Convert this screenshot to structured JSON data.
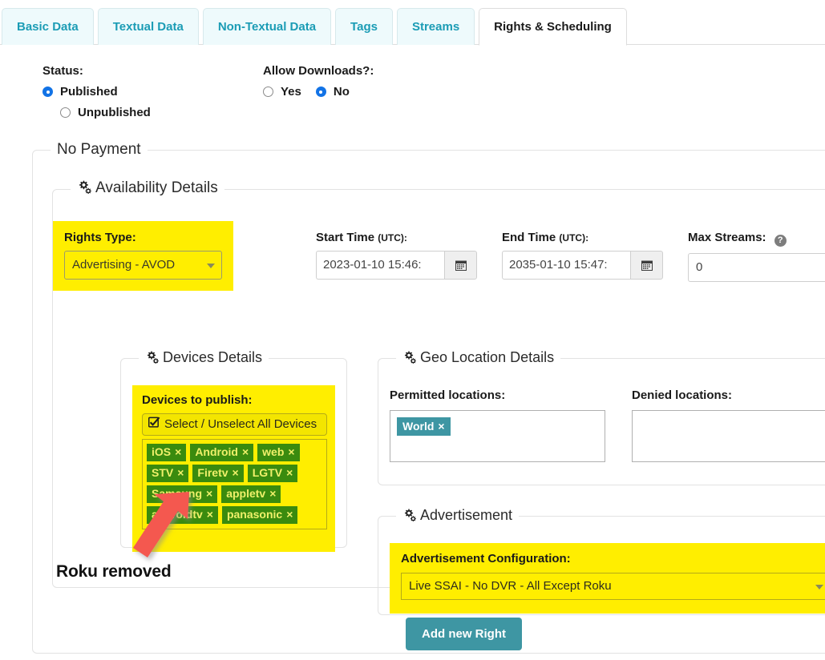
{
  "tabs": [
    {
      "label": "Basic Data",
      "active": false
    },
    {
      "label": "Textual Data",
      "active": false
    },
    {
      "label": "Non-Textual Data",
      "active": false
    },
    {
      "label": "Tags",
      "active": false
    },
    {
      "label": "Streams",
      "active": false
    },
    {
      "label": "Rights & Scheduling",
      "active": true
    }
  ],
  "status": {
    "label": "Status:",
    "options": [
      {
        "label": "Published",
        "checked": true
      },
      {
        "label": "Unpublished",
        "checked": false
      }
    ]
  },
  "downloads": {
    "label": "Allow Downloads?:",
    "options": [
      {
        "label": "Yes",
        "checked": false
      },
      {
        "label": "No",
        "checked": true
      }
    ]
  },
  "payment_fieldset": {
    "legend": "No Payment"
  },
  "availability": {
    "legend": "Availability Details",
    "rights_type": {
      "label": "Rights Type:",
      "value": "Advertising - AVOD"
    },
    "start_time": {
      "label": "Start Time",
      "unit": "(UTC):",
      "value": "2023-01-10 15:46:",
      "icon": "calendar-icon"
    },
    "end_time": {
      "label": "End Time",
      "unit": "(UTC):",
      "value": "2035-01-10 15:47:",
      "icon": "calendar-icon"
    },
    "max_streams": {
      "label": "Max Streams:",
      "value": "0",
      "help_icon": "help-circle-icon"
    }
  },
  "devices": {
    "legend": "Devices Details",
    "title": "Devices to publish:",
    "select_all_label": "Select / Unselect All Devices",
    "select_all_checked": true,
    "tags": [
      "iOS",
      "Android",
      "web",
      "STV",
      "Firetv",
      "LGTV",
      "Samsung",
      "appletv",
      "androidtv",
      "panasonic"
    ],
    "remove_glyph": "×"
  },
  "geo": {
    "legend": "Geo Location Details",
    "permitted": {
      "label": "Permitted locations:",
      "tags": [
        "World"
      ]
    },
    "denied": {
      "label": "Denied locations:",
      "tags": []
    },
    "remove_glyph": "×"
  },
  "advertisement": {
    "legend": "Advertisement",
    "config_label": "Advertisement Configuration:",
    "config_value": "Live SSAI - No DVR - All Except Roku"
  },
  "cta": {
    "label": "Add new Right"
  },
  "annotation": {
    "text": "Roku removed",
    "arrow_color": "#f4584f"
  },
  "colors": {
    "highlight": "#ffee00",
    "tab_active_text": "#1a1a1a",
    "tab_text": "#1b9cb5",
    "tab_bg": "#eefafc",
    "device_tag_bg": "#3a8b0e",
    "device_tag_text": "#f0f06a",
    "geo_tag_bg": "#3e96a3",
    "button_bg": "#3e96a3",
    "radio_checked": "#1273e6"
  }
}
